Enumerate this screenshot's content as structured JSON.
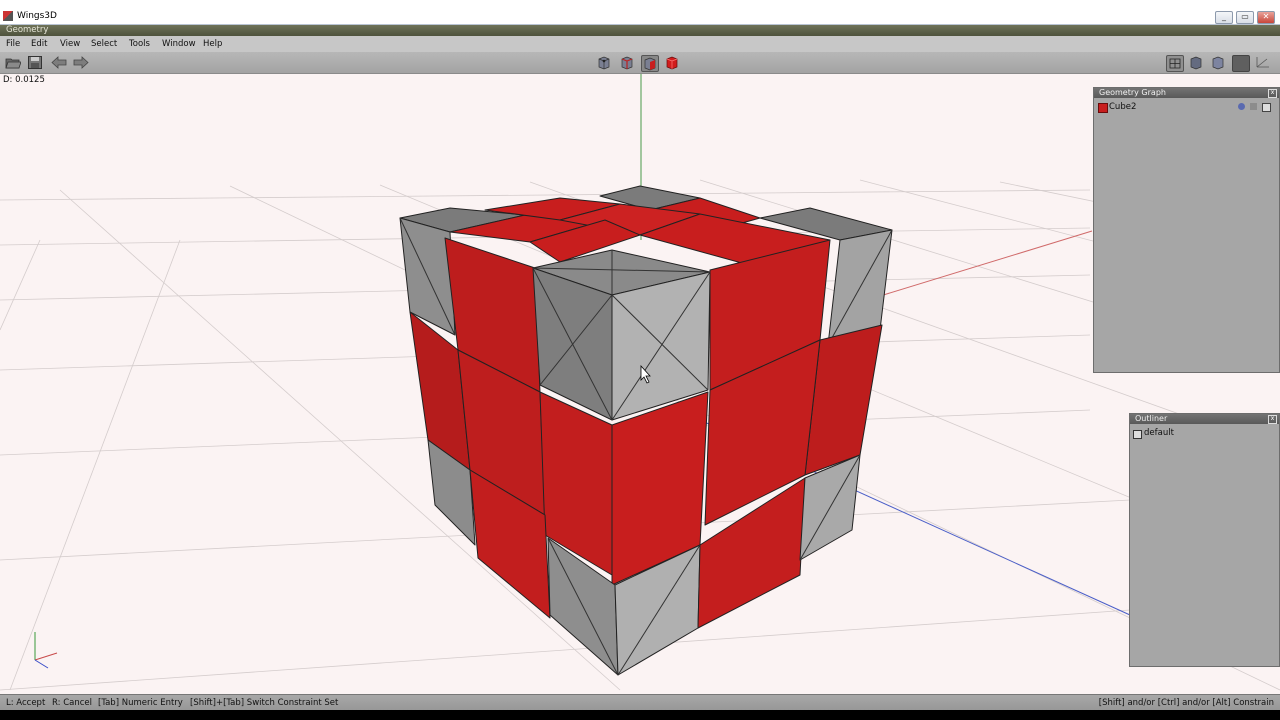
{
  "window": {
    "title": "Wings3D"
  },
  "geometry_window": {
    "title": "Geometry"
  },
  "menu": {
    "items": [
      "File",
      "Edit",
      "View",
      "Select",
      "Tools",
      "Window",
      "Help"
    ]
  },
  "viewport": {
    "readout": "D: 0.0125"
  },
  "geometry_graph": {
    "title": "Geometry Graph",
    "object": "Cube2"
  },
  "outliner": {
    "title": "Outliner",
    "item": "default"
  },
  "status": {
    "accept": "L: Accept",
    "cancel": "R: Cancel",
    "numeric": "[Tab] Numeric Entry",
    "switch_constraint": "[Shift]+[Tab] Switch Constraint Set",
    "constrain": "[Shift] and/or [Ctrl] and/or [Alt] Constrain"
  },
  "colors": {
    "selection": "#c81e1e",
    "mesh_gray": "#8e8e8e",
    "viewport_bg": "#fbf3f3"
  },
  "icons": [
    "open-file-icon",
    "save-icon",
    "undo-arrow-icon",
    "redo-arrow-icon",
    "vertex-mode-icon",
    "edge-mode-icon",
    "face-mode-icon",
    "body-mode-icon"
  ]
}
